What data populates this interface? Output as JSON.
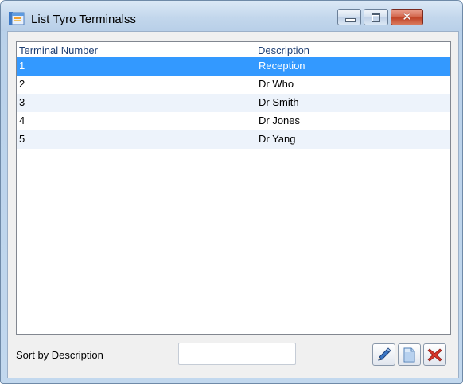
{
  "window": {
    "title": "List Tyro Terminalss"
  },
  "list": {
    "columns": [
      "Terminal Number",
      "Description"
    ],
    "rows": [
      {
        "number": "1",
        "description": "Reception"
      },
      {
        "number": "2",
        "description": "Dr Who"
      },
      {
        "number": "3",
        "description": "Dr Smith"
      },
      {
        "number": "4",
        "description": "Dr Jones"
      },
      {
        "number": "5",
        "description": "Dr Yang"
      }
    ],
    "selected_index": 0
  },
  "sort": {
    "label": "Sort by Description",
    "value": ""
  },
  "icons": {
    "app": "app-window-icon",
    "minimize": "minimize-icon",
    "maximize": "maximize-icon",
    "close": "close-icon",
    "edit": "pencil-icon",
    "new": "new-document-icon",
    "delete": "delete-x-icon"
  },
  "colors": {
    "selection": "#3399ff",
    "alt_row": "#edf3fb",
    "header_text": "#1f3f73",
    "close_button": "#c04327"
  }
}
